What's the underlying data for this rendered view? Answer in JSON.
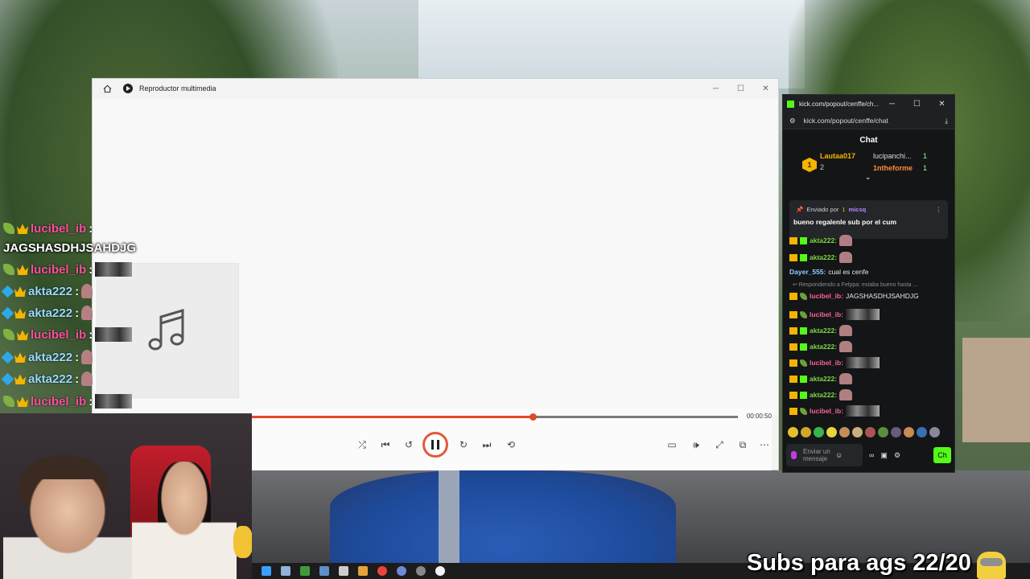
{
  "player": {
    "title": "Reproductor multimedia",
    "time": "00:00:50",
    "progress_fraction": 0.577,
    "accent": "#e04a2b"
  },
  "overlay": {
    "lines": [
      {
        "user": "lucibel_ib",
        "color": "pink",
        "badge": "pepper",
        "kind": "text",
        "text": "JAGSHASDHJSAHDJG"
      },
      {
        "user": "lucibel_ib",
        "color": "pink",
        "badge": "pepper",
        "kind": "emote-wide"
      },
      {
        "user": "akta222",
        "color": "blue",
        "badge": "cube",
        "kind": "emote-small"
      },
      {
        "user": "akta222",
        "color": "blue",
        "badge": "cube",
        "kind": "emote-small"
      },
      {
        "user": "lucibel_ib",
        "color": "pink",
        "badge": "pepper",
        "kind": "emote-wide"
      },
      {
        "user": "akta222",
        "color": "blue",
        "badge": "cube",
        "kind": "emote-small"
      },
      {
        "user": "akta222",
        "color": "blue",
        "badge": "cube",
        "kind": "emote-small"
      },
      {
        "user": "lucibel_ib",
        "color": "pink",
        "badge": "pepper",
        "kind": "emote-wide"
      }
    ],
    "colon": ":"
  },
  "kick": {
    "tab_title": "kick.com/popout/cenffe/ch...",
    "url": "kick.com/popout/cenffe/chat",
    "chat_header": "Chat",
    "leaderboard": {
      "rank": "1",
      "first": "Lautaa017",
      "first_count": "2",
      "second": "lucipanchi...",
      "second_count": "1",
      "third": "1ntheforme",
      "third_count": "1"
    },
    "pinned": {
      "sent_by": "Enviado por",
      "rank": "1",
      "user": "micsq",
      "message": "bueno regalenle sub por el cum"
    },
    "messages": [
      {
        "user": "akta222",
        "color": "g",
        "emote": "small"
      },
      {
        "user": "akta222",
        "color": "g",
        "emote": "small"
      },
      {
        "user": "Dayer_555",
        "color": "b",
        "text": "cual es cenfe"
      },
      {
        "user": "lucibel_ib",
        "color": "p",
        "text": "JAGSHASDHJSAHDJG",
        "reply": "Respondiendo a Felppa: estaba bueno hasta ..."
      },
      {
        "user": "lucibel_ib",
        "color": "p",
        "emote": "wide"
      },
      {
        "user": "akta222",
        "color": "g",
        "emote": "small"
      },
      {
        "user": "akta222",
        "color": "g",
        "emote": "small"
      },
      {
        "user": "lucibel_ib",
        "color": "p",
        "emote": "wide"
      },
      {
        "user": "akta222",
        "color": "g",
        "emote": "small"
      },
      {
        "user": "akta222",
        "color": "g",
        "emote": "small"
      },
      {
        "user": "lucibel_ib",
        "color": "p",
        "emote": "wide"
      }
    ],
    "input_placeholder": "Enviar un mensaje",
    "send_label": "Ch",
    "accent": "#53fc18"
  },
  "subs_text": "Subs para ags 22/20"
}
